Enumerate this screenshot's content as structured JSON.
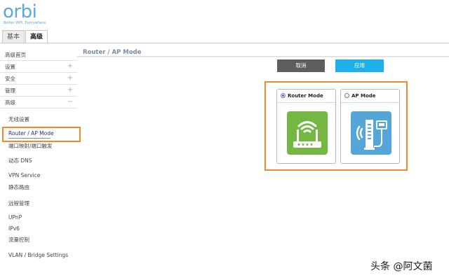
{
  "header": {
    "logo_text": "orbi",
    "tagline": "Better WiFi. Everywhere.",
    "tabs": [
      {
        "label": "基本",
        "active": false
      },
      {
        "label": "高级",
        "active": true
      }
    ]
  },
  "sidebar": {
    "home": "高级首页",
    "sections": [
      {
        "label": "设置",
        "toggle": "+"
      },
      {
        "label": "安全",
        "toggle": "+"
      },
      {
        "label": "管理",
        "toggle": "+"
      },
      {
        "label": "高级",
        "toggle": "−"
      }
    ],
    "sub_items": [
      "无线设置",
      "Router / AP Mode",
      "端口映射/端口触发",
      "动态 DNS",
      "VPN Service",
      "静态路由",
      "远程管理",
      "UPnP",
      "IPv6",
      "流量控制",
      "VLAN / Bridge Settings"
    ]
  },
  "main": {
    "title": "Router / AP Mode",
    "cancel_label": "取消",
    "apply_label": "应用",
    "modes": [
      {
        "label": "Router Mode",
        "selected": true
      },
      {
        "label": "AP Mode",
        "selected": false
      }
    ]
  },
  "colors": {
    "accent": "#1eb0ea",
    "highlight": "#f08a2b",
    "router_icon": "#74b843",
    "ap_icon": "#55a6d8"
  },
  "icons": {
    "router_mode": "wifi-router-icon",
    "ap_mode": "access-point-icon"
  },
  "watermark": "头条 @阿文菌"
}
